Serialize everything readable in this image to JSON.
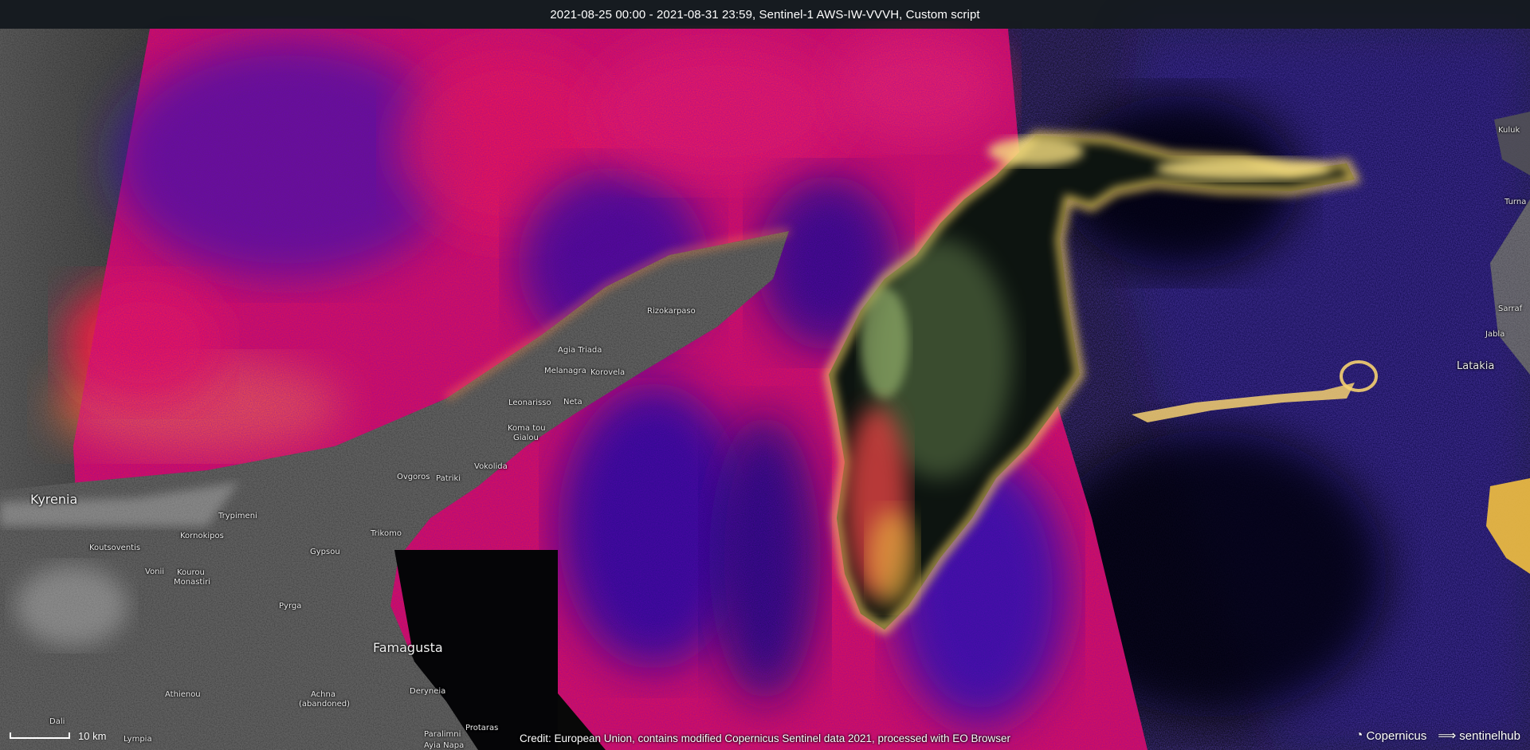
{
  "header": {
    "title": "2021-08-25 00:00 - 2021-08-31 23:59, Sentinel-1 AWS-IW-VVVH, Custom script"
  },
  "places": {
    "kyrenia": "Kyrenia",
    "famagusta": "Famagusta",
    "latakia": "Latakia",
    "rizokarpaso": "Rizokarpaso",
    "agia_triada": "Agia Triada",
    "melanagra": "Melanagra",
    "korovia": "Korovela",
    "leonarisso": "Leonarisso",
    "neta": "Neta",
    "koma_tou_gialou_1": "Koma tou",
    "koma_tou_gialou_2": "Gialou",
    "vokolida": "Vokolida",
    "ovgoros": "Ovgoros",
    "patriki": "Patriki",
    "trypimeni": "Trypimeni",
    "kornokipos": "Kornokipos",
    "koutsoventis": "Koutsoventis",
    "trikomo": "Trikomo",
    "gypsou": "Gypsou",
    "vonii": "Vonii",
    "kourou_monastiri_1": "Kourou",
    "kourou_monastiri_2": "Monastiri",
    "pyrga": "Pyrga",
    "achna_1": "Achna",
    "achna_2": "(abandoned)",
    "athienou": "Athienou",
    "deryneia": "Deryneia",
    "lympia": "Lympia",
    "paralimni": "Paralimni",
    "protaras": "Protaras",
    "ayia_napa": "Ayia Napa",
    "dali": "Dali",
    "kuluk": "Kuluk",
    "turna": "Turna",
    "sarraf": "Sarraf",
    "jabla": "Jabla"
  },
  "scale": {
    "label": "10 km"
  },
  "credit": {
    "text": "Credit: European Union, contains modified Copernicus Sentinel data 2021, processed with EO Browser"
  },
  "logos": {
    "copernicus": "Copernicus",
    "sentinelhub": "sentinelhub"
  },
  "colors": {
    "background": "#0a0a0c",
    "sea_red": "#ff1a3c",
    "sea_blue": "#2a0f9e",
    "slick_yellow": "#f5d060",
    "slick_orange": "#ff8a3a",
    "land_gray": "#4a4a4a"
  }
}
